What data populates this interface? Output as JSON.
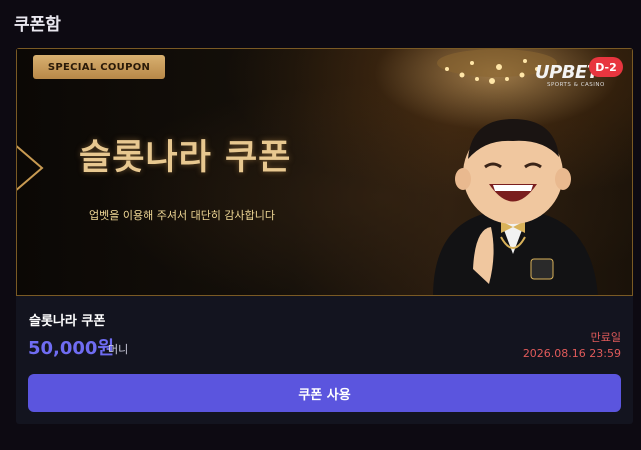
{
  "page": {
    "title": "쿠폰함"
  },
  "banner": {
    "badge": "SPECIAL COUPON",
    "headline": "슬롯나라 쿠폰",
    "subline": "업벳을 이용해 주셔서 대단히 감사합니다",
    "logo": "UPBET",
    "logo_sub": "SPORTS & CASINO",
    "dday": "D-2"
  },
  "coupon": {
    "name": "슬롯나라 쿠폰",
    "amount": "50,000원",
    "unit": "머니",
    "expiry_label": "만료일",
    "expiry_date": "2026.08.16 23:59",
    "use_button": "쿠폰 사용"
  },
  "colors": {
    "accent": "#5b55de",
    "amount": "#6f6cf2",
    "expiry": "#e05a5a",
    "gold": "#e8c890"
  }
}
